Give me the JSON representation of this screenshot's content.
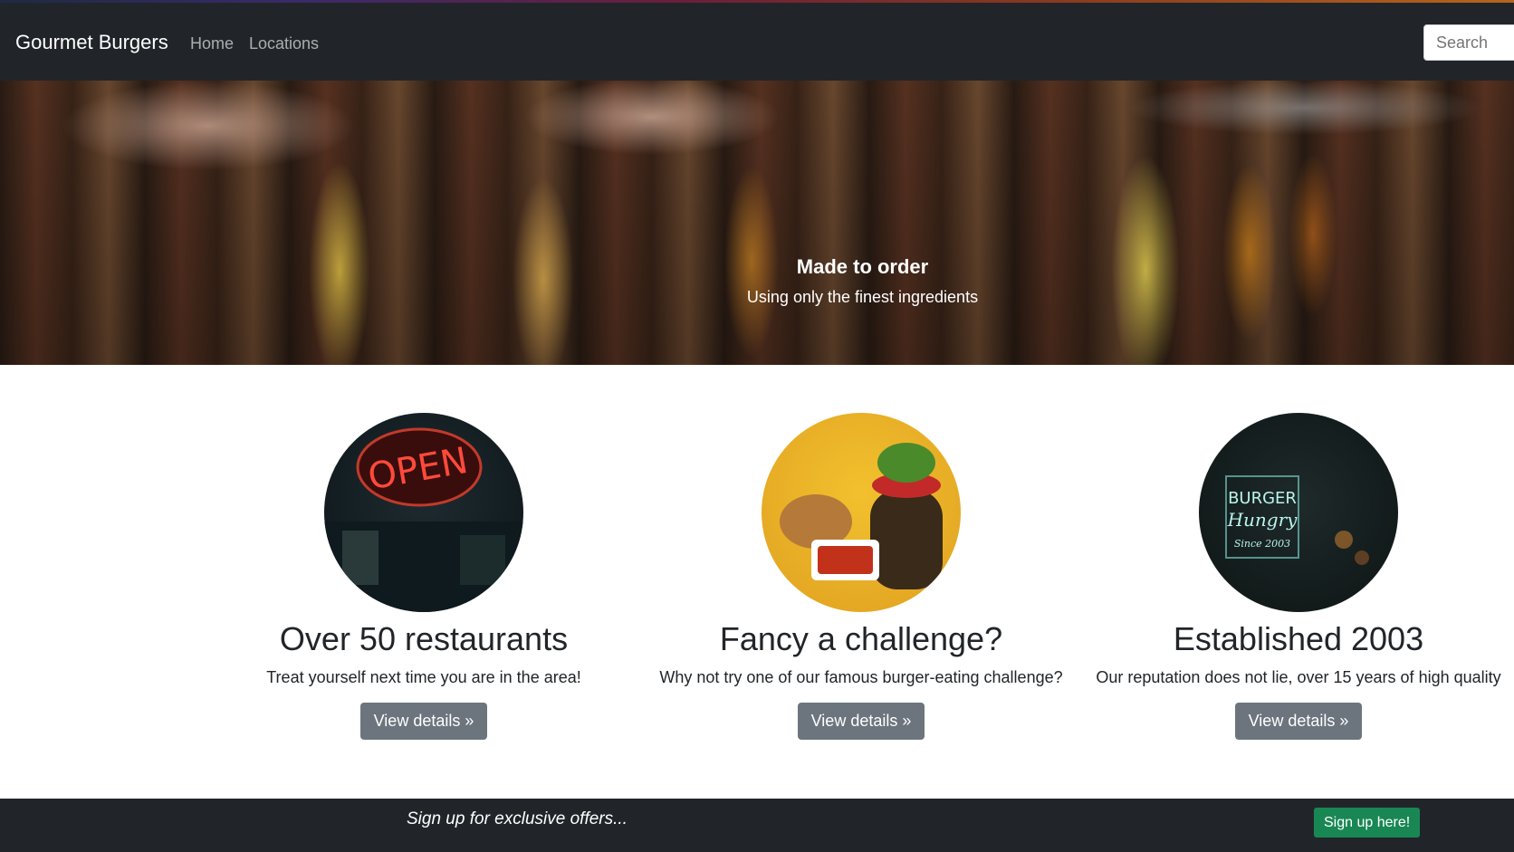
{
  "navbar": {
    "brand": "Gourmet Burgers",
    "links": [
      {
        "label": "Home"
      },
      {
        "label": "Locations"
      }
    ],
    "search": {
      "placeholder": "Search"
    }
  },
  "hero": {
    "title": "Made to order",
    "subtitle": "Using only the finest ingredients"
  },
  "features": [
    {
      "image": "open-neon-sign-photo",
      "heading": "Over 50 restaurants",
      "text": "Treat yourself next time you are in the area!",
      "button": "View details »"
    },
    {
      "image": "burger-and-wedges-photo",
      "heading": "Fancy a challenge?",
      "text": "Why not try one of our famous burger-eating challenge?",
      "button": "View details »"
    },
    {
      "image": "burger-neon-sign-photo",
      "heading": "Established 2003",
      "text": "Our reputation does not lie, over 15 years of high quality",
      "button": "View details »"
    }
  ],
  "footer": {
    "text": "Sign up for exclusive offers...",
    "button": "Sign up here!"
  },
  "colors": {
    "navbar_bg": "#212529",
    "button_secondary": "#6c757d",
    "button_success": "#198754"
  }
}
